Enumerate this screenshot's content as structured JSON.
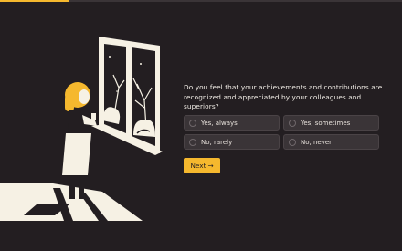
{
  "progress": {
    "value_percent": 17,
    "accent_color": "#f5b82e"
  },
  "illustration": {
    "name": "woman-at-window"
  },
  "question": {
    "text": "Do you feel that your achievements and contributions are recognized and appreciated by your colleagues and superiors?"
  },
  "options": [
    {
      "label": "Yes, always"
    },
    {
      "label": "Yes, sometimes"
    },
    {
      "label": "No, rarely"
    },
    {
      "label": "No, never"
    }
  ],
  "next_button": {
    "label": "Next",
    "icon": "arrow-right-icon",
    "arrow": "→"
  },
  "colors": {
    "background": "#231e21",
    "option_bg": "#3a3437",
    "text": "#f3efe8"
  }
}
